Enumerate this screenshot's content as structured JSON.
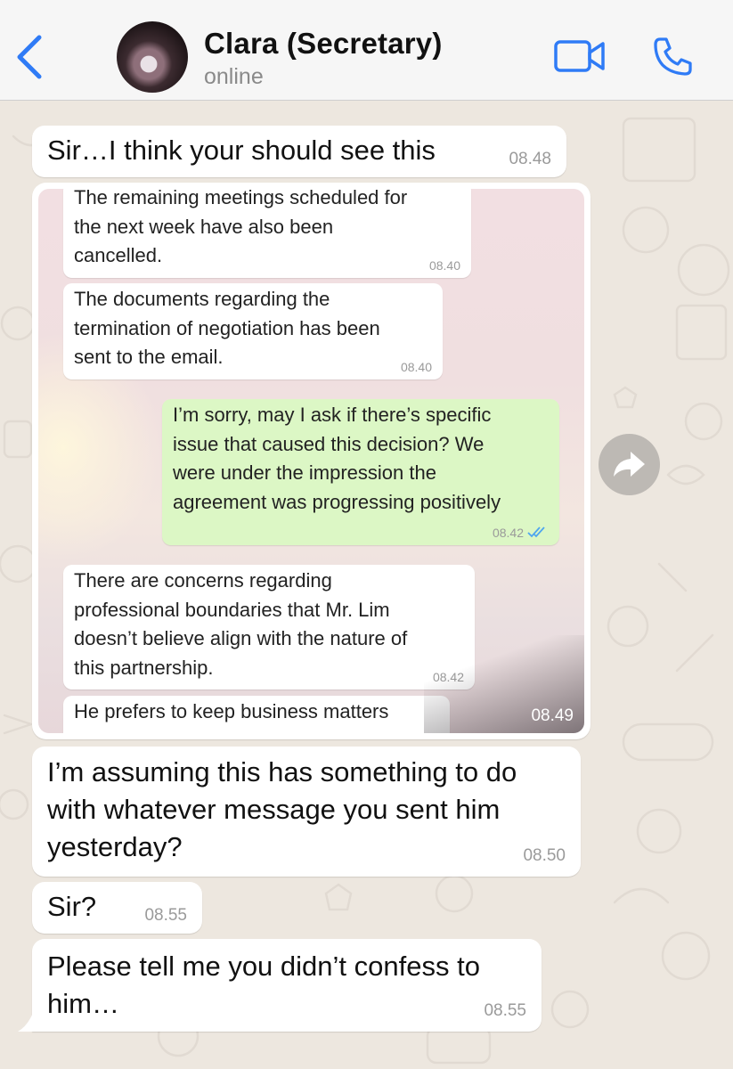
{
  "header": {
    "contact_name": "Clara (Secretary)",
    "status": "online"
  },
  "colors": {
    "accent": "#2f7bf6",
    "outgoing_bubble": "#dcf7c5",
    "read_ticks": "#4fa6ef"
  },
  "messages": [
    {
      "text": "Sir…I think your should see this",
      "time": "08.48"
    },
    {
      "text": "I’m assuming this has something to do\nwith whatever message you sent him\nyesterday?",
      "time": "08.50"
    },
    {
      "text": "Sir?",
      "time": "08.55"
    },
    {
      "text": "Please tell me you didn’t confess to\nhim…",
      "time": "08.55"
    }
  ],
  "screenshot": {
    "time": "08.49",
    "messages": [
      {
        "text": "The remaining meetings scheduled for\nthe next week have also been\ncancelled.",
        "time": "08.40"
      },
      {
        "text": "The documents regarding the\ntermination of negotiation has been\nsent to the email.",
        "time": "08.40"
      },
      {
        "text": "I’m sorry, may I ask if there’s specific\nissue that caused this decision? We\nwere under the impression the\nagreement was progressing positively",
        "time": "08.42"
      },
      {
        "text": "There are concerns regarding\nprofessional boundaries that Mr. Lim\ndoesn’t believe align with the nature of\nthis partnership.",
        "time": "08.42"
      },
      {
        "text": "He prefers to keep business matters",
        "time": ""
      }
    ]
  }
}
